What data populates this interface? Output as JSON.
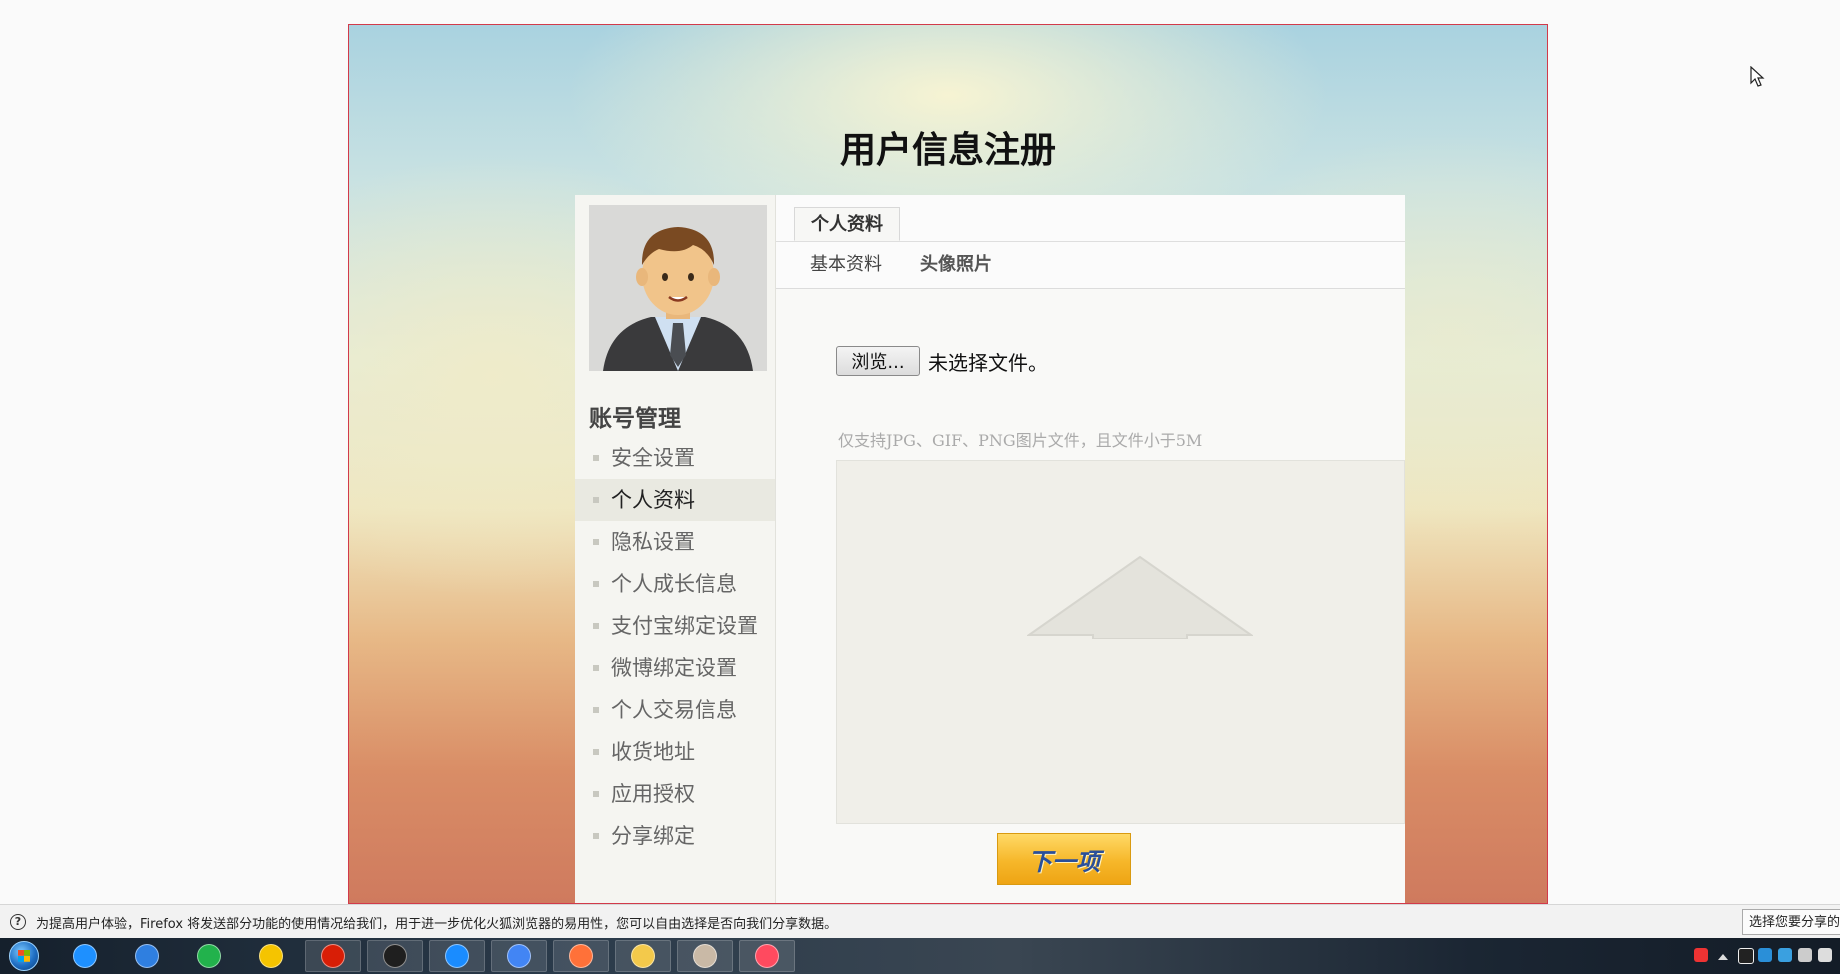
{
  "page": {
    "title": "用户信息注册"
  },
  "sidebar": {
    "avatar_alt": "用户头像",
    "heading": "账号管理",
    "items": [
      {
        "label": "安全设置",
        "active": false
      },
      {
        "label": "个人资料",
        "active": true
      },
      {
        "label": "隐私设置",
        "active": false
      },
      {
        "label": "个人成长信息",
        "active": false
      },
      {
        "label": "支付宝绑定设置",
        "active": false
      },
      {
        "label": "微博绑定设置",
        "active": false
      },
      {
        "label": "个人交易信息",
        "active": false
      },
      {
        "label": "收货地址",
        "active": false
      },
      {
        "label": "应用授权",
        "active": false
      },
      {
        "label": "分享绑定",
        "active": false
      }
    ]
  },
  "main": {
    "top_tab": "个人资料",
    "sub_tabs": [
      {
        "label": "基本资料",
        "active": false
      },
      {
        "label": "头像照片",
        "active": true
      }
    ],
    "upload": {
      "browse_label": "浏览...",
      "file_status": "未选择文件。"
    },
    "hint": "仅支持JPG、GIF、PNG图片文件，且文件小于5M",
    "next_label": "下一项"
  },
  "notification": {
    "text": "为提高用户体验，Firefox 将发送部分功能的使用情况给我们，用于进一步优化火狐浏览器的易用性，您可以自由选择是否向我们分享数据。",
    "button_label": "选择您要分享的数据"
  },
  "taskbar": {
    "apps": [
      {
        "name": "ie-icon",
        "color": "#1e90ff"
      },
      {
        "name": "baidu-netdisk-icon",
        "color": "#2f7fe0"
      },
      {
        "name": "media-player-icon",
        "color": "#22b24c"
      },
      {
        "name": "qq-music-icon",
        "color": "#f5c400"
      },
      {
        "name": "netease-music-icon",
        "color": "#d81e06"
      },
      {
        "name": "webstorm-icon",
        "color": "#1f1f1f"
      },
      {
        "name": "qq-browser-icon",
        "color": "#1a8cff"
      },
      {
        "name": "chrome-icon",
        "color": "#4285f4"
      },
      {
        "name": "firefox-icon",
        "color": "#ff7139"
      },
      {
        "name": "file-explorer-icon",
        "color": "#f3c94b"
      },
      {
        "name": "photo-viewer-icon",
        "color": "#c9b9a6"
      },
      {
        "name": "screen-recorder-icon",
        "color": "#ff4a5f"
      }
    ]
  },
  "colors": {
    "frame_border": "#d23a4a",
    "next_button": "#f6b72a",
    "active_item_bg": "#e9e9e1"
  }
}
